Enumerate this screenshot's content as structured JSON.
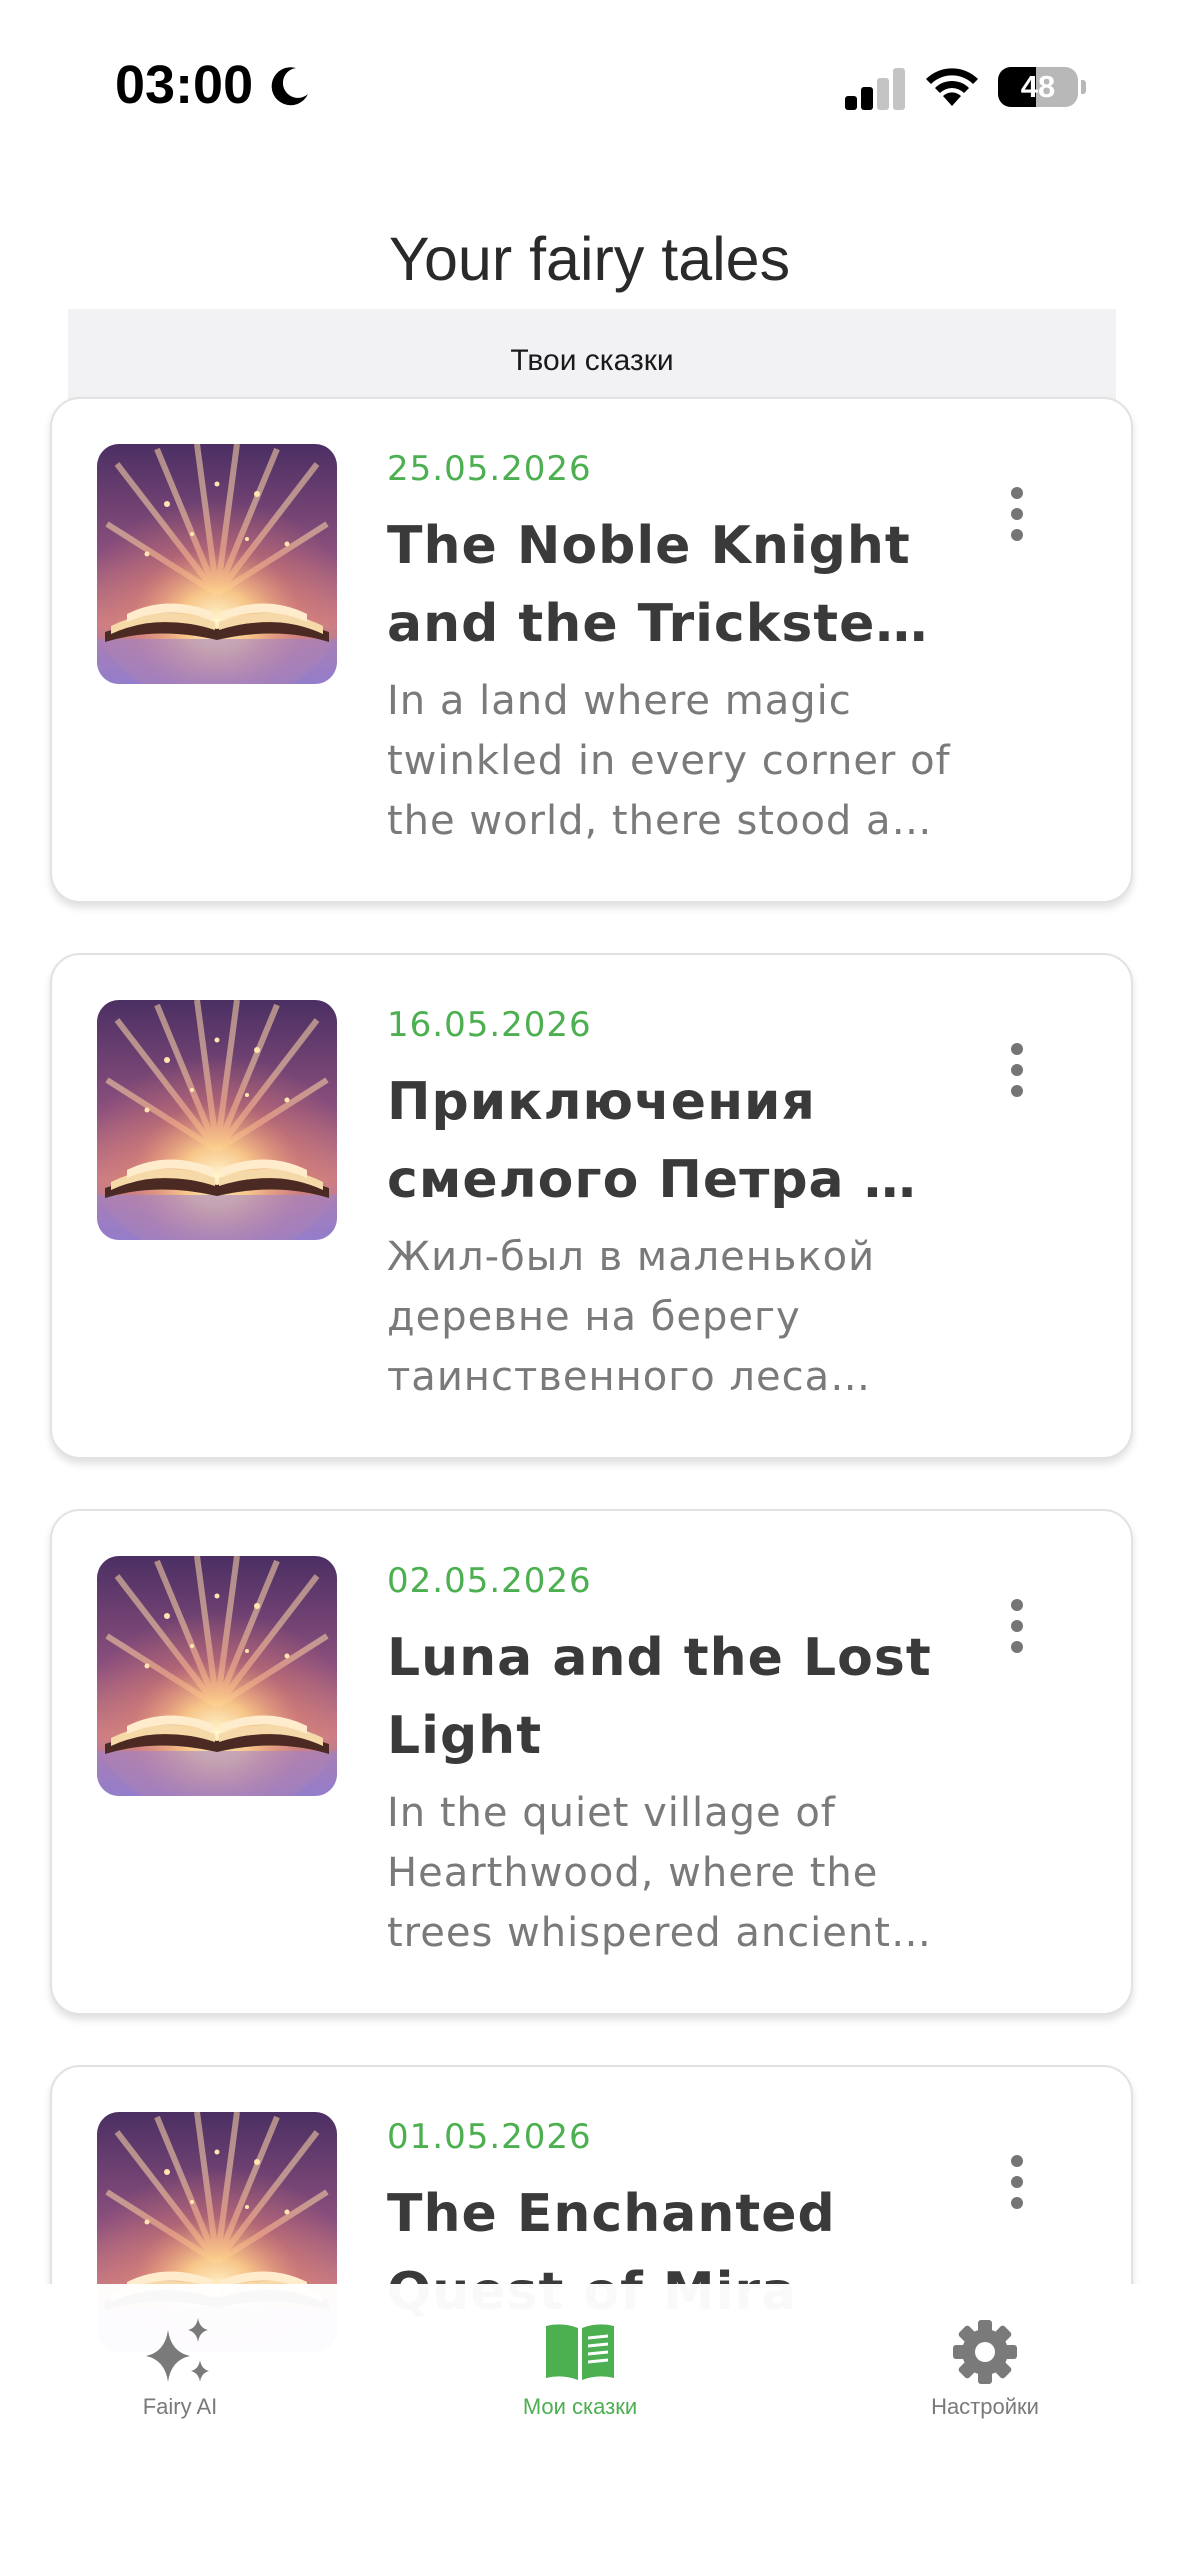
{
  "status_bar": {
    "time": "03:00",
    "battery_level": "48",
    "battery_fraction": 0.48,
    "icons": [
      "moon-icon",
      "signal-icon",
      "wifi-icon",
      "battery-icon"
    ]
  },
  "header": {
    "title": "Your fairy tales",
    "subtitle": "Твои сказки"
  },
  "colors": {
    "accent": "#4caf50",
    "title_text": "#3a3a3a",
    "excerpt_text": "#7a7a7a"
  },
  "stories": [
    {
      "date": "25.05.2026",
      "title": "The Noble Knight and the Trickster Tale",
      "excerpt": "In a land where magic twinkled in every corner of the world, there stood a castle",
      "icon": "open-book-icon"
    },
    {
      "date": "16.05.2026",
      "title": "Приключения смелого Петра и волшебного леса",
      "excerpt": "Жил-был в маленькой деревне на берегу таинственного леса мальчик",
      "icon": "open-book-icon"
    },
    {
      "date": "02.05.2026",
      "title": "Luna and the Lost Light",
      "excerpt": "In the quiet village of Hearthwood, where the trees whispered ancient secrets",
      "icon": "open-book-icon"
    },
    {
      "date": "01.05.2026",
      "title": "The Enchanted Quest of Mira",
      "excerpt": "",
      "icon": "open-book-icon"
    }
  ],
  "tab_bar": {
    "tabs": [
      {
        "label": "Fairy AI",
        "icon": "sparkles-icon",
        "active": false
      },
      {
        "label": "Мои сказки",
        "icon": "book-icon",
        "active": true
      },
      {
        "label": "Настройки",
        "icon": "gear-icon",
        "active": false
      }
    ]
  }
}
